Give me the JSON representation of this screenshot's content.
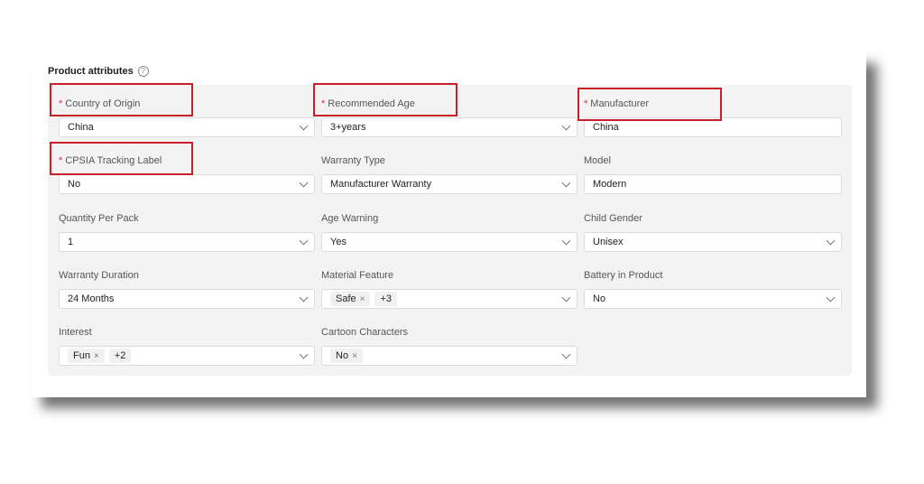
{
  "section": {
    "title": "Product attributes",
    "help_icon": "?"
  },
  "fields": {
    "country_of_origin": {
      "label": "Country of Origin",
      "required": true,
      "value": "China"
    },
    "recommended_age": {
      "label": "Recommended Age",
      "required": true,
      "value": "3+years"
    },
    "manufacturer": {
      "label": "Manufacturer",
      "required": true,
      "value": "China"
    },
    "cpsia_tracking_label": {
      "label": "CPSIA Tracking Label",
      "required": true,
      "value": "No"
    },
    "warranty_type": {
      "label": "Warranty Type",
      "value": "Manufacturer Warranty"
    },
    "model": {
      "label": "Model",
      "value": "Modern"
    },
    "quantity_per_pack": {
      "label": "Quantity Per Pack",
      "value": "1"
    },
    "age_warning": {
      "label": "Age Warning",
      "value": "Yes"
    },
    "child_gender": {
      "label": "Child Gender",
      "value": "Unisex"
    },
    "warranty_duration": {
      "label": "Warranty Duration",
      "value": "24 Months"
    },
    "material_feature": {
      "label": "Material Feature",
      "tags": [
        "Safe"
      ],
      "more": "+3"
    },
    "battery_in_product": {
      "label": "Battery in Product",
      "value": "No"
    },
    "interest": {
      "label": "Interest",
      "tags": [
        "Fun"
      ],
      "more": "+2"
    },
    "cartoon_characters": {
      "label": "Cartoon Characters",
      "tags": [
        "No"
      ]
    }
  },
  "symbols": {
    "required": "*",
    "remove": "×"
  },
  "colors": {
    "highlight": "#c8202a",
    "required": "#e0243a",
    "panel": "#f4f3f4"
  }
}
